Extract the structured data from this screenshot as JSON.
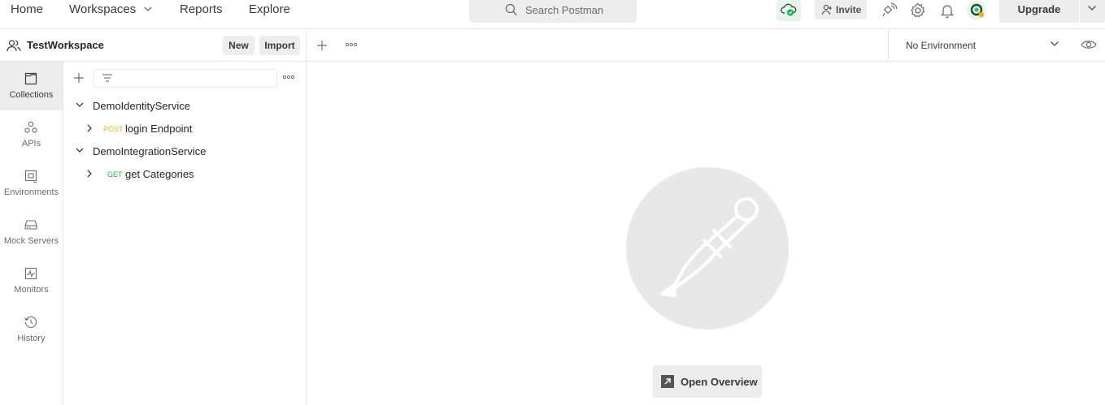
{
  "nav": {
    "home": "Home",
    "workspaces": "Workspaces",
    "reports": "Reports",
    "explore": "Explore"
  },
  "search": {
    "placeholder": "Search Postman"
  },
  "header_actions": {
    "invite": "Invite",
    "upgrade": "Upgrade",
    "sync_status_color": "#0cbb52"
  },
  "workspace": {
    "name": "TestWorkspace",
    "new_label": "New",
    "import_label": "Import"
  },
  "environment": {
    "selected": "No Environment"
  },
  "rail": {
    "items": [
      {
        "label": "Collections",
        "icon": "collections-icon",
        "active": true
      },
      {
        "label": "APIs",
        "icon": "apis-icon",
        "active": false
      },
      {
        "label": "Environments",
        "icon": "environments-icon",
        "active": false
      },
      {
        "label": "Mock Servers",
        "icon": "mock-servers-icon",
        "active": false
      },
      {
        "label": "Monitors",
        "icon": "monitors-icon",
        "active": false
      },
      {
        "label": "History",
        "icon": "history-icon",
        "active": false
      }
    ]
  },
  "collections": [
    {
      "name": "DemoIdentityService",
      "expanded": true,
      "requests": [
        {
          "method": "POST",
          "name": "login Endpoint"
        }
      ]
    },
    {
      "name": "DemoIntegrationService",
      "expanded": true,
      "requests": [
        {
          "method": "GET",
          "name": "get Categories"
        }
      ]
    }
  ],
  "main": {
    "open_overview": "Open Overview"
  },
  "colors": {
    "post": "#f2b022",
    "get": "#2bb24c",
    "button_bg": "#ededed"
  }
}
